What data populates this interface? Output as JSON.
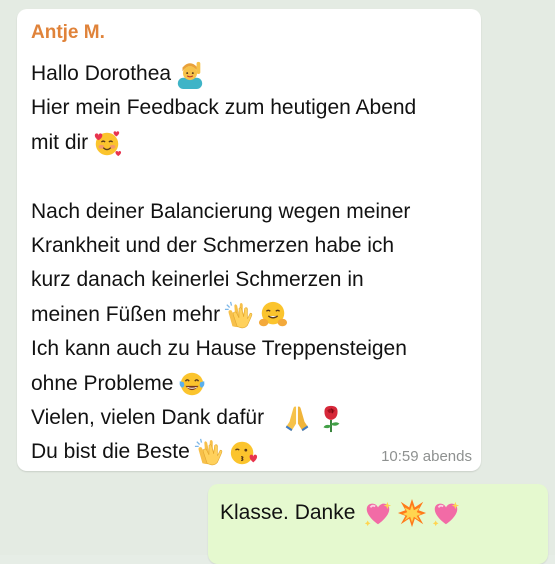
{
  "incoming": {
    "sender": "Antje M.",
    "lines": [
      {
        "text": "Hallo Dorothea",
        "emojis": [
          "person-raising-hand-emoji"
        ]
      },
      {
        "text": "Hier mein Feedback zum heutigen Abend",
        "emojis": []
      },
      {
        "text": "mit dir",
        "emojis": [
          "smiling-face-with-hearts-emoji"
        ]
      },
      {
        "text": "",
        "emojis": []
      },
      {
        "text": "Nach deiner Balancierung wegen meiner",
        "emojis": []
      },
      {
        "text": "Krankheit und der Schmerzen habe ich",
        "emojis": []
      },
      {
        "text": "kurz danach keinerlei Schmerzen in",
        "emojis": []
      },
      {
        "text": "meinen Füßen mehr",
        "emojis": [
          "clapping-hands-emoji",
          "hugging-face-emoji"
        ]
      },
      {
        "text": "Ich kann auch zu Hause Treppensteigen",
        "emojis": []
      },
      {
        "text": "ohne Probleme",
        "emojis": [
          "face-with-tears-of-joy-emoji"
        ]
      },
      {
        "text": "Vielen,  vielen Dank dafür",
        "emojis": [
          "folded-hands-emoji",
          "rose-emoji"
        ]
      },
      {
        "text": "Du bist die Beste",
        "emojis": [
          "clapping-hands-emoji",
          "face-blowing-kiss-emoji"
        ]
      }
    ],
    "time": "10:59 abends"
  },
  "outgoing": {
    "text": "Klasse. Danke",
    "emojis": [
      "sparkling-heart-emoji",
      "collision-emoji",
      "sparkling-heart-emoji"
    ]
  },
  "colors": {
    "background": "#e4ebe3",
    "incoming_bubble": "#ffffff",
    "outgoing_bubble": "#e5f9cf",
    "sender_name": "#e0833a",
    "timestamp": "#8e9190"
  }
}
